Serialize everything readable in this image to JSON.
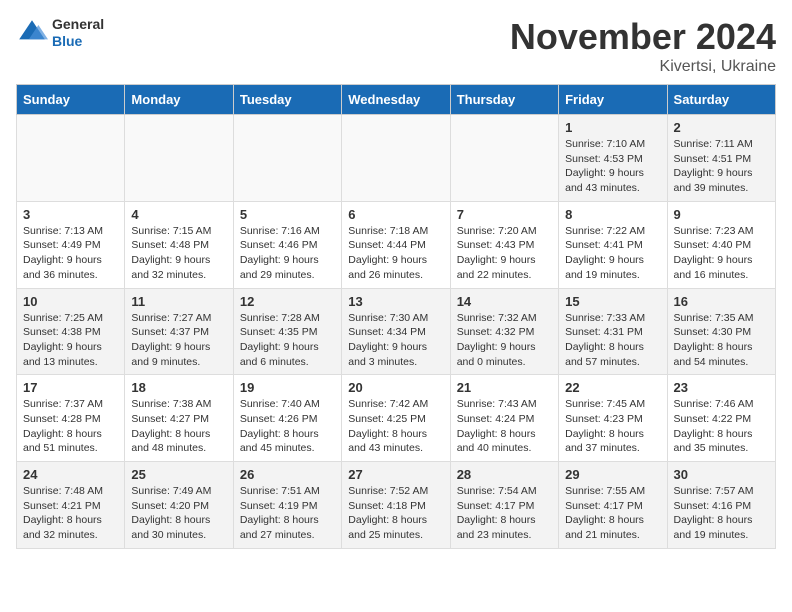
{
  "logo": {
    "general": "General",
    "blue": "Blue"
  },
  "header": {
    "month": "November 2024",
    "location": "Kivertsi, Ukraine"
  },
  "weekdays": [
    "Sunday",
    "Monday",
    "Tuesday",
    "Wednesday",
    "Thursday",
    "Friday",
    "Saturday"
  ],
  "weeks": [
    [
      {
        "day": "",
        "info": ""
      },
      {
        "day": "",
        "info": ""
      },
      {
        "day": "",
        "info": ""
      },
      {
        "day": "",
        "info": ""
      },
      {
        "day": "",
        "info": ""
      },
      {
        "day": "1",
        "info": "Sunrise: 7:10 AM\nSunset: 4:53 PM\nDaylight: 9 hours\nand 43 minutes."
      },
      {
        "day": "2",
        "info": "Sunrise: 7:11 AM\nSunset: 4:51 PM\nDaylight: 9 hours\nand 39 minutes."
      }
    ],
    [
      {
        "day": "3",
        "info": "Sunrise: 7:13 AM\nSunset: 4:49 PM\nDaylight: 9 hours\nand 36 minutes."
      },
      {
        "day": "4",
        "info": "Sunrise: 7:15 AM\nSunset: 4:48 PM\nDaylight: 9 hours\nand 32 minutes."
      },
      {
        "day": "5",
        "info": "Sunrise: 7:16 AM\nSunset: 4:46 PM\nDaylight: 9 hours\nand 29 minutes."
      },
      {
        "day": "6",
        "info": "Sunrise: 7:18 AM\nSunset: 4:44 PM\nDaylight: 9 hours\nand 26 minutes."
      },
      {
        "day": "7",
        "info": "Sunrise: 7:20 AM\nSunset: 4:43 PM\nDaylight: 9 hours\nand 22 minutes."
      },
      {
        "day": "8",
        "info": "Sunrise: 7:22 AM\nSunset: 4:41 PM\nDaylight: 9 hours\nand 19 minutes."
      },
      {
        "day": "9",
        "info": "Sunrise: 7:23 AM\nSunset: 4:40 PM\nDaylight: 9 hours\nand 16 minutes."
      }
    ],
    [
      {
        "day": "10",
        "info": "Sunrise: 7:25 AM\nSunset: 4:38 PM\nDaylight: 9 hours\nand 13 minutes."
      },
      {
        "day": "11",
        "info": "Sunrise: 7:27 AM\nSunset: 4:37 PM\nDaylight: 9 hours\nand 9 minutes."
      },
      {
        "day": "12",
        "info": "Sunrise: 7:28 AM\nSunset: 4:35 PM\nDaylight: 9 hours\nand 6 minutes."
      },
      {
        "day": "13",
        "info": "Sunrise: 7:30 AM\nSunset: 4:34 PM\nDaylight: 9 hours\nand 3 minutes."
      },
      {
        "day": "14",
        "info": "Sunrise: 7:32 AM\nSunset: 4:32 PM\nDaylight: 9 hours\nand 0 minutes."
      },
      {
        "day": "15",
        "info": "Sunrise: 7:33 AM\nSunset: 4:31 PM\nDaylight: 8 hours\nand 57 minutes."
      },
      {
        "day": "16",
        "info": "Sunrise: 7:35 AM\nSunset: 4:30 PM\nDaylight: 8 hours\nand 54 minutes."
      }
    ],
    [
      {
        "day": "17",
        "info": "Sunrise: 7:37 AM\nSunset: 4:28 PM\nDaylight: 8 hours\nand 51 minutes."
      },
      {
        "day": "18",
        "info": "Sunrise: 7:38 AM\nSunset: 4:27 PM\nDaylight: 8 hours\nand 48 minutes."
      },
      {
        "day": "19",
        "info": "Sunrise: 7:40 AM\nSunset: 4:26 PM\nDaylight: 8 hours\nand 45 minutes."
      },
      {
        "day": "20",
        "info": "Sunrise: 7:42 AM\nSunset: 4:25 PM\nDaylight: 8 hours\nand 43 minutes."
      },
      {
        "day": "21",
        "info": "Sunrise: 7:43 AM\nSunset: 4:24 PM\nDaylight: 8 hours\nand 40 minutes."
      },
      {
        "day": "22",
        "info": "Sunrise: 7:45 AM\nSunset: 4:23 PM\nDaylight: 8 hours\nand 37 minutes."
      },
      {
        "day": "23",
        "info": "Sunrise: 7:46 AM\nSunset: 4:22 PM\nDaylight: 8 hours\nand 35 minutes."
      }
    ],
    [
      {
        "day": "24",
        "info": "Sunrise: 7:48 AM\nSunset: 4:21 PM\nDaylight: 8 hours\nand 32 minutes."
      },
      {
        "day": "25",
        "info": "Sunrise: 7:49 AM\nSunset: 4:20 PM\nDaylight: 8 hours\nand 30 minutes."
      },
      {
        "day": "26",
        "info": "Sunrise: 7:51 AM\nSunset: 4:19 PM\nDaylight: 8 hours\nand 27 minutes."
      },
      {
        "day": "27",
        "info": "Sunrise: 7:52 AM\nSunset: 4:18 PM\nDaylight: 8 hours\nand 25 minutes."
      },
      {
        "day": "28",
        "info": "Sunrise: 7:54 AM\nSunset: 4:17 PM\nDaylight: 8 hours\nand 23 minutes."
      },
      {
        "day": "29",
        "info": "Sunrise: 7:55 AM\nSunset: 4:17 PM\nDaylight: 8 hours\nand 21 minutes."
      },
      {
        "day": "30",
        "info": "Sunrise: 7:57 AM\nSunset: 4:16 PM\nDaylight: 8 hours\nand 19 minutes."
      }
    ]
  ]
}
